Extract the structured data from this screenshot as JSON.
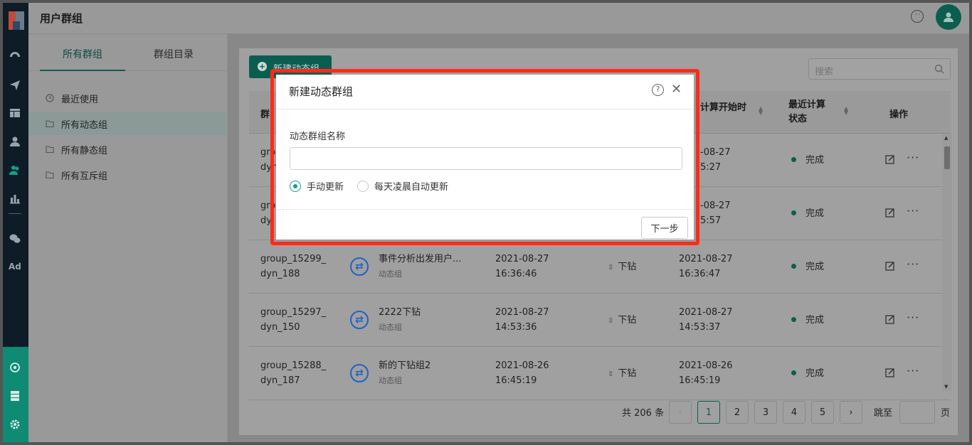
{
  "header": {
    "title": "用户群组"
  },
  "sidebar": {
    "tabs": [
      {
        "label": "所有群组"
      },
      {
        "label": "群组目录"
      }
    ],
    "items": [
      {
        "label": "最近使用"
      },
      {
        "label": "所有动态组"
      },
      {
        "label": "所有静态组"
      },
      {
        "label": "所有互斥组"
      }
    ]
  },
  "rail": {
    "ad_label": "Ad"
  },
  "main": {
    "new_button": "新建动态组",
    "search_placeholder": "搜索",
    "table": {
      "headers": [
        "群",
        "计算开始时",
        "最近计算状态",
        "操作"
      ],
      "rows": [
        {
          "id": "gro",
          "id2": "dyn",
          "calc_time": "-08-27",
          "calc_time2": "5:27",
          "status": "完成"
        },
        {
          "id": "gro",
          "id2": "dy",
          "calc_time": "-08-27",
          "calc_time2": "5:57",
          "status": "完成"
        },
        {
          "id": "group_15299_",
          "id2": "dyn_188",
          "name": "事件分析出发用户...",
          "type": "动态组",
          "created": "2021-08-27",
          "created2": "16:36:46",
          "drill": "下钻",
          "calc_time": "2021-08-27",
          "calc_time2": "16:36:47",
          "status": "完成"
        },
        {
          "id": "group_15297_",
          "id2": "dyn_150",
          "name": "2222下钻",
          "type": "动态组",
          "created": "2021-08-27",
          "created2": "14:53:36",
          "drill": "下钻",
          "calc_time": "2021-08-27",
          "calc_time2": "14:53:37",
          "status": "完成"
        },
        {
          "id": "group_15288_",
          "id2": "dyn_187",
          "name": "新的下钻组2",
          "type": "动态组",
          "created": "2021-08-26",
          "created2": "16:45:19",
          "drill": "下钻",
          "calc_time": "2021-08-26",
          "calc_time2": "16:45:19",
          "status": "完成"
        }
      ]
    },
    "pagination": {
      "total_text": "共 206 条",
      "pages": [
        "1",
        "2",
        "3",
        "4",
        "5"
      ],
      "current": "1",
      "jump_label": "跳至",
      "page_unit": "页"
    }
  },
  "modal": {
    "title": "新建动态群组",
    "field_label": "动态群组名称",
    "field_value": "",
    "radio_options": [
      {
        "label": "手动更新",
        "selected": true
      },
      {
        "label": "每天凌晨自动更新",
        "selected": false
      }
    ],
    "next_button": "下一步"
  },
  "colors": {
    "accent": "#0b5e4f",
    "highlight_border": "#ff2a1a",
    "link_blue": "#1f63c4"
  }
}
